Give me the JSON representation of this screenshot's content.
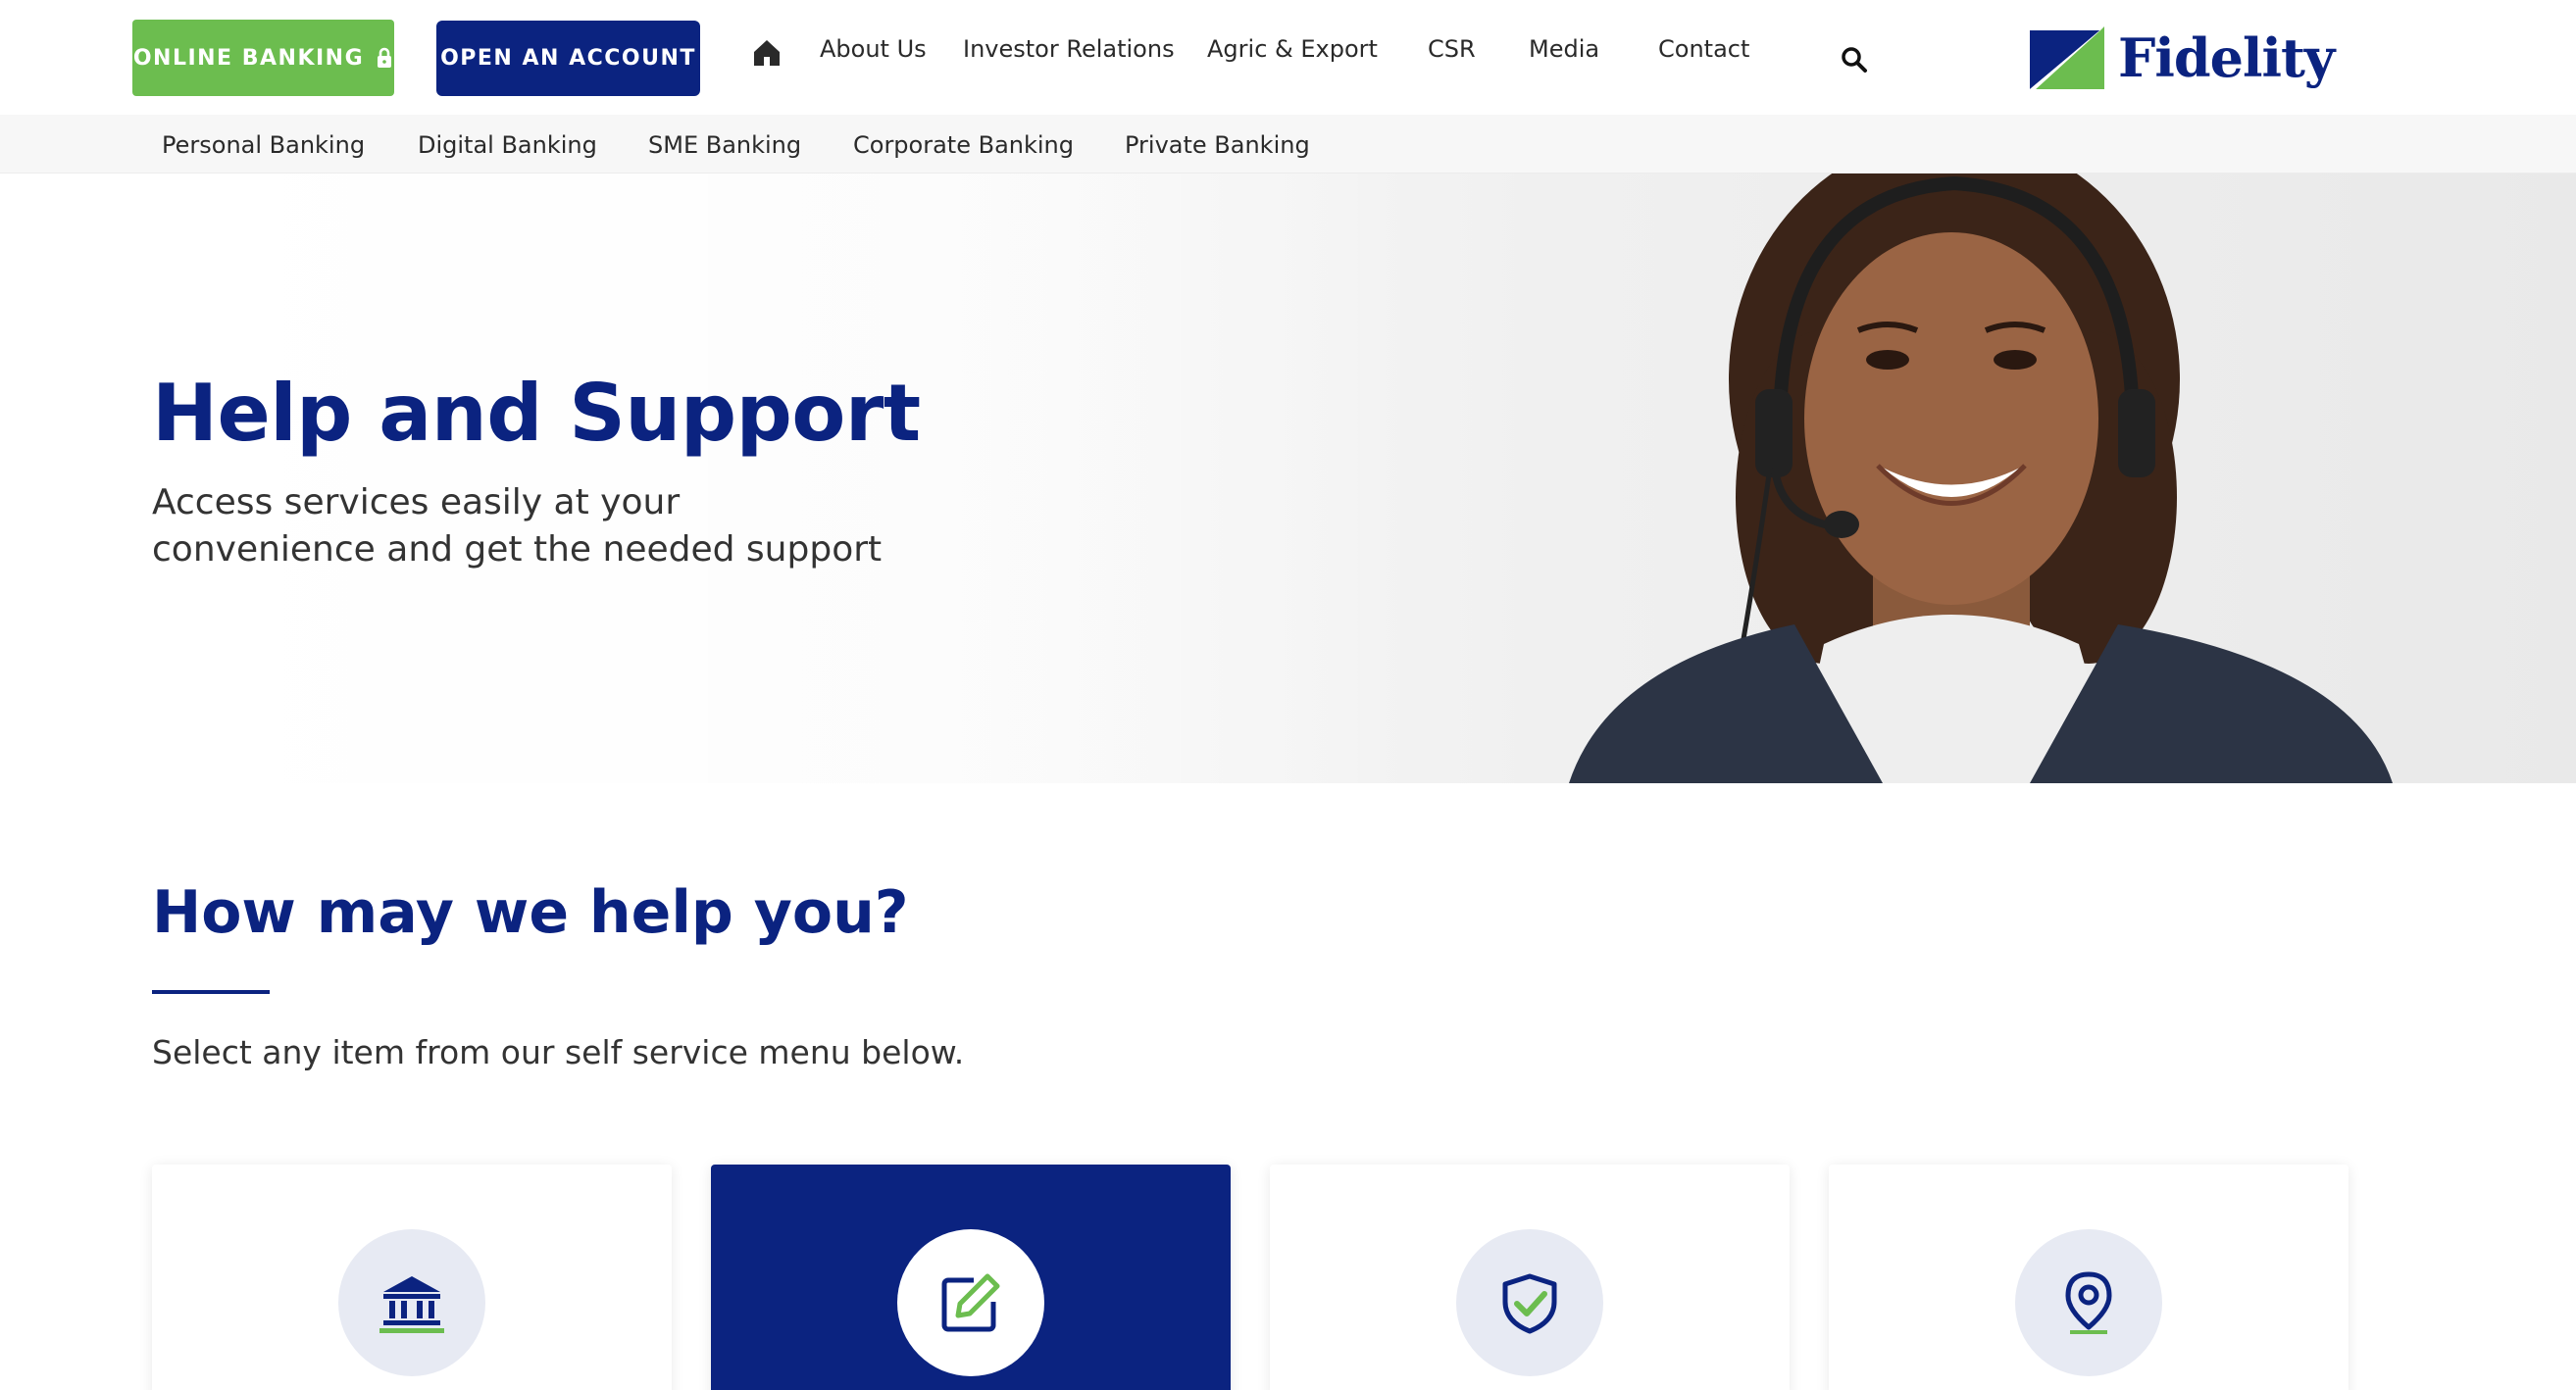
{
  "header": {
    "online_banking_label": "ONLINE BANKING",
    "open_account_label": "OPEN AN ACCOUNT",
    "nav": [
      "About Us",
      "Investor Relations",
      "Agric & Export",
      "CSR",
      "Media",
      "Contact"
    ],
    "brand_name": "Fidelity"
  },
  "subnav": [
    "Personal Banking",
    "Digital Banking",
    "SME Banking",
    "Corporate Banking",
    "Private Banking"
  ],
  "hero": {
    "title": "Help and Support",
    "subtitle": "Access services easily at your convenience and get the needed support"
  },
  "help": {
    "title": "How may we help you?",
    "subtitle": "Select any item from our self service menu below.",
    "cards": [
      {
        "icon": "bank-icon",
        "active": false
      },
      {
        "icon": "edit-icon",
        "active": true
      },
      {
        "icon": "shield-check-icon",
        "active": false
      },
      {
        "icon": "location-pin-icon",
        "active": false
      }
    ]
  },
  "colors": {
    "brand_blue": "#0b2380",
    "brand_green": "#6cbd4f",
    "card_circle": "#e7eaf3"
  },
  "icons": [
    "lock-icon",
    "home-icon",
    "search-icon",
    "fidelity-logo-mark",
    "bank-icon",
    "edit-icon",
    "shield-check-icon",
    "location-pin-icon"
  ]
}
